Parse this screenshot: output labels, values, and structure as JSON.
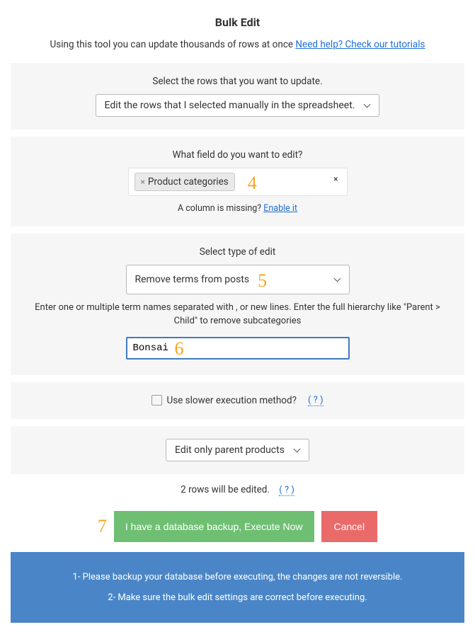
{
  "title": "Bulk Edit",
  "subtitle_prefix": "Using this tool you can update thousands of rows at once ",
  "subtitle_link": "Need help? Check our tutorials",
  "rows_section": {
    "label": "Select the rows that you want to update.",
    "value": "Edit the rows that I selected manually in the spreadsheet."
  },
  "field_section": {
    "label": "What field do you want to edit?",
    "chip": "Product categories",
    "missing_prefix": "A column is missing? ",
    "missing_link": "Enable it",
    "badge": "4"
  },
  "edit_type_section": {
    "label": "Select type of edit",
    "value": "Remove terms from posts",
    "badge": "5",
    "desc": "Enter one or multiple term names separated with , or new lines. Enter the full hierarchy like \"Parent > Child\" to remove subcategories",
    "input_value": "Bonsai",
    "input_badge": "6"
  },
  "slower_section": {
    "label": "Use slower execution method?",
    "help": "( ? )"
  },
  "parent_section": {
    "value": "Edit only parent products"
  },
  "status": {
    "text": "2 rows will be edited.",
    "help": "( ? )"
  },
  "actions": {
    "badge": "7",
    "execute": "I have a database backup, Execute Now",
    "cancel": "Cancel"
  },
  "notice": {
    "line1": "1- Please backup your database before executing, the changes are not reversible.",
    "line2": "2- Make sure the bulk edit settings are correct before executing."
  }
}
